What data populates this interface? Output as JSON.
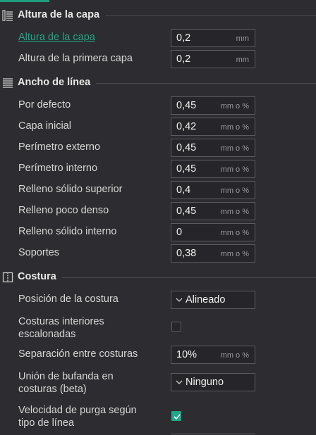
{
  "sections": {
    "layer_height": {
      "title": "Altura de la capa",
      "icon": "layer-height-icon",
      "rows": [
        {
          "label": "Altura de la capa",
          "value": "0,2",
          "unit": "mm",
          "active": true
        },
        {
          "label": "Altura de la primera capa",
          "value": "0,2",
          "unit": "mm"
        }
      ]
    },
    "line_width": {
      "title": "Ancho de línea",
      "icon": "line-width-icon",
      "rows": [
        {
          "label": "Por defecto",
          "value": "0,45",
          "unit": "mm o %"
        },
        {
          "label": "Capa inicial",
          "value": "0,42",
          "unit": "mm o %"
        },
        {
          "label": "Perímetro externo",
          "value": "0,45",
          "unit": "mm o %"
        },
        {
          "label": "Perímetro interno",
          "value": "0,45",
          "unit": "mm o %"
        },
        {
          "label": "Relleno sólido superior",
          "value": "0,4",
          "unit": "mm o %"
        },
        {
          "label": "Relleno poco denso",
          "value": "0,45",
          "unit": "mm o %"
        },
        {
          "label": "Relleno sólido interno",
          "value": "0",
          "unit": "mm o %"
        },
        {
          "label": "Soportes",
          "value": "0,38",
          "unit": "mm o %"
        }
      ]
    },
    "seam": {
      "title": "Costura",
      "icon": "seam-icon",
      "seam_position": {
        "label": "Posición de la costura",
        "value": "Alineado"
      },
      "staggered": {
        "label": "Costuras interiores escalonadas",
        "checked": false
      },
      "seam_gap": {
        "label": "Separación entre costuras",
        "value": "10%",
        "unit": "mm o %"
      },
      "scarf": {
        "label": "Unión de bufanda en costuras (beta)",
        "value": "Ninguno"
      },
      "wipe_speed": {
        "label": "Velocidad de purga según tipo de línea",
        "checked": true
      }
    }
  },
  "colors": {
    "accent": "#1fa787",
    "background": "#2d2d31",
    "field_border": "#5a5a60"
  }
}
